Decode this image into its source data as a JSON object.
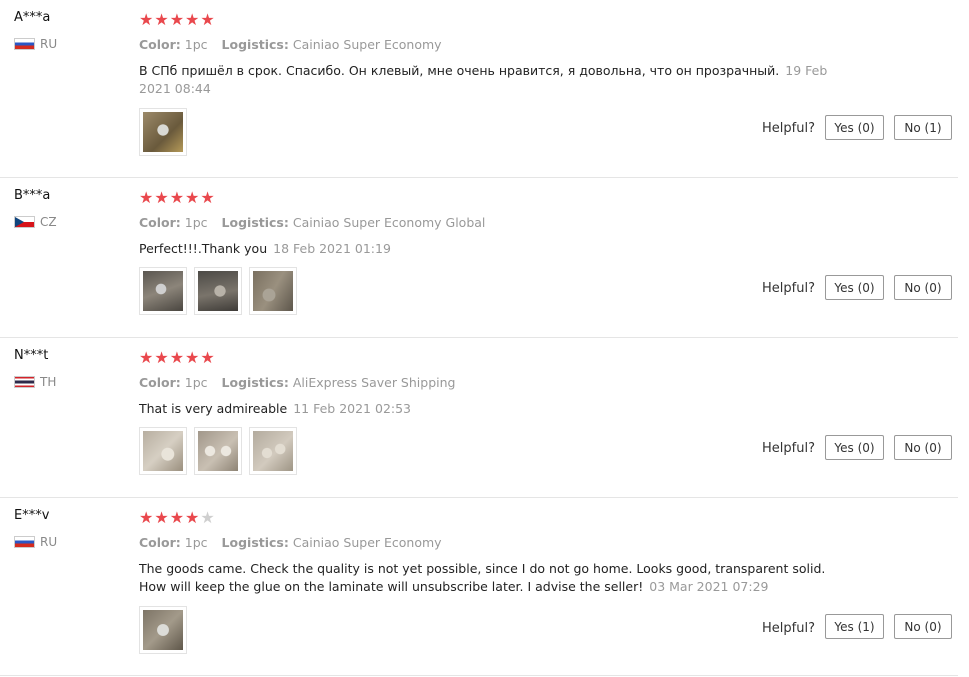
{
  "helpful_label": "Helpful?",
  "reviews": [
    {
      "user": "A***a",
      "country_code": "RU",
      "flag": "flag-ru-icon",
      "rating": 5,
      "color_label": "Color:",
      "color_value": "1pc",
      "logistics_label": "Logistics:",
      "logistics_value": "Cainiao Super Economy",
      "text": "В СПб пришёл в срок. Спасибо. Он клевый, мне очень нравится, я довольна, что он прозрачный.",
      "date": "19 Feb 2021 08:44",
      "photo_count": 1,
      "yes": "Yes (0)",
      "no": "No (1)"
    },
    {
      "user": "B***a",
      "country_code": "CZ",
      "flag": "flag-cz-icon",
      "rating": 5,
      "color_label": "Color:",
      "color_value": "1pc",
      "logistics_label": "Logistics:",
      "logistics_value": "Cainiao Super Economy Global",
      "text": "Perfect!!!.Thank you",
      "date": "18 Feb 2021 01:19",
      "photo_count": 3,
      "yes": "Yes (0)",
      "no": "No (0)"
    },
    {
      "user": "N***t",
      "country_code": "TH",
      "flag": "flag-th-icon",
      "rating": 5,
      "color_label": "Color:",
      "color_value": "1pc",
      "logistics_label": "Logistics:",
      "logistics_value": "AliExpress Saver Shipping",
      "text": "That is very admireable",
      "date": "11 Feb 2021 02:53",
      "photo_count": 3,
      "yes": "Yes (0)",
      "no": "No (0)"
    },
    {
      "user": "E***v",
      "country_code": "RU",
      "flag": "flag-ru-icon",
      "rating": 4,
      "color_label": "Color:",
      "color_value": "1pc",
      "logistics_label": "Logistics:",
      "logistics_value": "Cainiao Super Economy",
      "text": "The goods came. Check the quality is not yet possible, since I do not go home. Looks good, transparent solid. How will keep the glue on the laminate will unsubscribe later. I advise the seller!",
      "date": "03 Mar 2021 07:29",
      "photo_count": 1,
      "yes": "Yes (1)",
      "no": "No (0)"
    }
  ]
}
